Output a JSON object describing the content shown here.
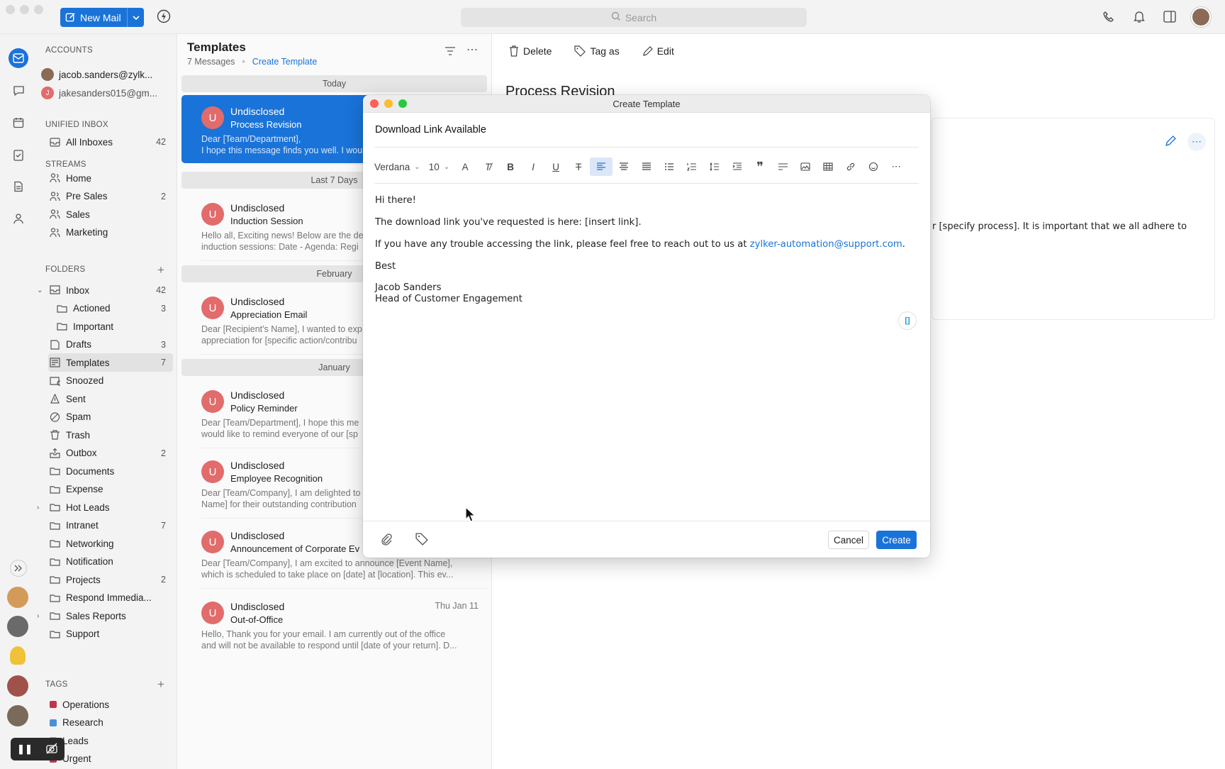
{
  "toolbar": {
    "new_mail_label": "New Mail",
    "search_placeholder": "Search"
  },
  "sidebar": {
    "accounts_heading": "ACCOUNTS",
    "accounts": [
      {
        "label": "jacob.sanders@zylk..."
      },
      {
        "label": "jakesanders015@gm...",
        "initial": "J"
      }
    ],
    "unified_heading": "UNIFIED INBOX",
    "all_inboxes": {
      "label": "All Inboxes",
      "count": "42"
    },
    "streams_heading": "STREAMS",
    "streams": [
      {
        "label": "Home",
        "count": ""
      },
      {
        "label": "Pre Sales",
        "count": "2"
      },
      {
        "label": "Sales",
        "count": ""
      },
      {
        "label": "Marketing",
        "count": ""
      }
    ],
    "folders_heading": "FOLDERS",
    "folders": [
      {
        "label": "Inbox",
        "count": "42"
      },
      {
        "label": "Actioned",
        "count": "3"
      },
      {
        "label": "Important",
        "count": ""
      },
      {
        "label": "Drafts",
        "count": "3"
      },
      {
        "label": "Templates",
        "count": "7"
      },
      {
        "label": "Snoozed",
        "count": ""
      },
      {
        "label": "Sent",
        "count": ""
      },
      {
        "label": "Spam",
        "count": ""
      },
      {
        "label": "Trash",
        "count": ""
      },
      {
        "label": "Outbox",
        "count": "2"
      },
      {
        "label": "Documents",
        "count": ""
      },
      {
        "label": "Expense",
        "count": ""
      },
      {
        "label": "Hot Leads",
        "count": ""
      },
      {
        "label": "Intranet",
        "count": "7"
      },
      {
        "label": "Networking",
        "count": ""
      },
      {
        "label": "Notification",
        "count": ""
      },
      {
        "label": "Projects",
        "count": "2"
      },
      {
        "label": "Respond Immedia...",
        "count": ""
      },
      {
        "label": "Sales Reports",
        "count": ""
      },
      {
        "label": "Support",
        "count": ""
      }
    ],
    "tags_heading": "TAGS",
    "tags": [
      {
        "label": "Operations",
        "color": "#c2344d"
      },
      {
        "label": "Research",
        "color": "#4a90d9"
      },
      {
        "label": "Leads",
        "color": "#e8a33d"
      },
      {
        "label": "Urgent",
        "color": "#c2344d"
      }
    ]
  },
  "list": {
    "title": "Templates",
    "count_text": "7 Messages",
    "create_link": "Create Template",
    "groups": [
      "Today",
      "Last 7 Days",
      "February",
      "January"
    ],
    "items": [
      {
        "from": "Undisclosed",
        "subject": "Process Revision",
        "preview": "Dear [Team/Department],\nI hope this message finds you well. I wou",
        "date": ""
      },
      {
        "from": "Undisclosed",
        "subject": "Induction Session",
        "preview": "Hello all, Exciting news! Below are the de\ninduction sessions: Date - Agenda: Regi",
        "date": ""
      },
      {
        "from": "Undisclosed",
        "subject": "Appreciation Email",
        "preview": "Dear [Recipient's Name], I wanted to exp\nappreciation for [specific action/contribu",
        "date": ""
      },
      {
        "from": "Undisclosed",
        "subject": "Policy Reminder",
        "preview": "Dear [Team/Department], I hope this me\nwould like to remind everyone of our [sp",
        "date": ""
      },
      {
        "from": "Undisclosed",
        "subject": "Employee Recognition",
        "preview": "Dear [Team/Company], I am delighted to\nName] for their outstanding contribution",
        "date": ""
      },
      {
        "from": "Undisclosed",
        "subject": "Announcement of Corporate Ev",
        "preview": "Dear [Team/Company], I am excited to announce [Event Name],\nwhich is scheduled to take place on [date] at [location]. This ev...",
        "date": ""
      },
      {
        "from": "Undisclosed",
        "subject": "Out-of-Office",
        "preview": "Hello, Thank you for your email. I am currently out of the office\nand will not be available to respond until [date of your return]. D...",
        "date": "Thu Jan 11"
      }
    ]
  },
  "reading": {
    "delete": "Delete",
    "tag_as": "Tag as",
    "edit": "Edit",
    "title": "Process Revision",
    "snippet": "r [specify process]. It is important that we all adhere to"
  },
  "modal": {
    "window_title": "Create Template",
    "template_name": "Download Link Available",
    "font": "Verdana",
    "size": "10",
    "line1": "Hi there!",
    "line2": "The download link you've requested is here: [insert link].",
    "line3": "If you have any trouble accessing the link, please feel free to reach out to us at ",
    "email": "zylker-automation@support.com",
    "line3_end": ".",
    "closing": "Best",
    "sig_name": "Jacob Sanders",
    "sig_title": "Head of Customer Engagement",
    "cancel": "Cancel",
    "create": "Create"
  },
  "user_initial": "U"
}
